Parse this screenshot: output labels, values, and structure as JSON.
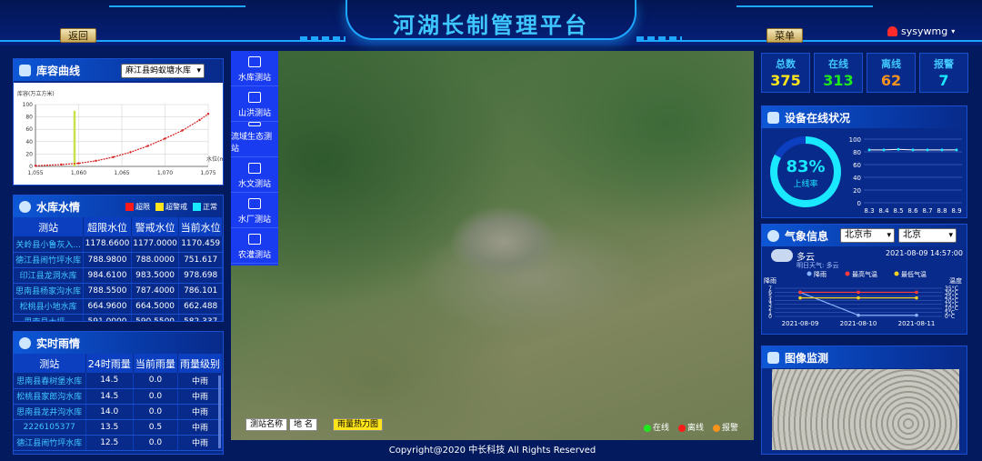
{
  "header": {
    "title": "河湖长制管理平台",
    "back_label": "返回",
    "menu_label": "菜单",
    "username": "sysywmg",
    "user_caret": "▾"
  },
  "reservoir_curve": {
    "title": "库容曲线",
    "selected_reservoir": "麻江县蚂蚁塘水库",
    "chart_data": {
      "type": "line",
      "ylabel": "库容(万立方米)",
      "xlabel": "水位(m)",
      "xlim": [
        1055,
        1075
      ],
      "ylim": [
        0,
        100
      ],
      "x_ticks": [
        "1,055",
        "1,060",
        "1,065",
        "1,070",
        "1,075"
      ],
      "y_ticks": [
        "0",
        "20",
        "40",
        "60",
        "80",
        "100"
      ],
      "series": [
        {
          "values_x": [
            1055,
            1058,
            1060,
            1062,
            1064,
            1066,
            1068,
            1070,
            1072,
            1074,
            1075
          ],
          "values_y": [
            1,
            3,
            5,
            9,
            15,
            23,
            33,
            45,
            58,
            75,
            85
          ],
          "color": "#d81e1e"
        }
      ],
      "marker": {
        "x": 1059.5,
        "y": 90,
        "color": "#c8e04a"
      }
    }
  },
  "reservoir_water": {
    "title": "水库水情",
    "legend": [
      {
        "label": "超限",
        "color": "#ff1a1a"
      },
      {
        "label": "超警戒",
        "color": "#ffe51a"
      },
      {
        "label": "正常",
        "color": "#1ae8ff"
      }
    ],
    "columns": [
      "测站",
      "超限水位",
      "警戒水位",
      "当前水位"
    ],
    "rows": [
      [
        "关岭县小鲁灰入...",
        "1178.6600",
        "1177.0000",
        "1170.459"
      ],
      [
        "德江县闹竹坪水库",
        "788.9800",
        "788.0000",
        "751.617"
      ],
      [
        "印江县龙洞水库",
        "984.6100",
        "983.5000",
        "978.698"
      ],
      [
        "思南县杨家沟水库",
        "788.5500",
        "787.4000",
        "786.101"
      ],
      [
        "松桃县小地水库",
        "664.9600",
        "664.5000",
        "662.488"
      ],
      [
        "思南县大坪...",
        "591.0000",
        "590.5500",
        "582.337"
      ]
    ]
  },
  "rainfall": {
    "title": "实时雨情",
    "columns": [
      "测站",
      "24时雨量",
      "当前雨量",
      "雨量级别"
    ],
    "rows": [
      [
        "思南县春树堡水库",
        "14.5",
        "0.0",
        "中雨"
      ],
      [
        "松桃县家郎沟水库",
        "14.5",
        "0.0",
        "中雨"
      ],
      [
        "思南县龙井沟水库",
        "14.0",
        "0.0",
        "中雨"
      ],
      [
        "2226105377",
        "13.5",
        "0.5",
        "中雨"
      ],
      [
        "德江县闹竹坪水库",
        "12.5",
        "0.0",
        "中雨"
      ]
    ]
  },
  "map": {
    "side_menu": [
      {
        "label": "水库测站",
        "icon": "water-wave-icon"
      },
      {
        "label": "山洪测站",
        "icon": "mountain-flood-icon"
      },
      {
        "label": "流域生态测站",
        "icon": "eco-station-icon"
      },
      {
        "label": "水文测站",
        "icon": "hydrology-icon"
      },
      {
        "label": "水厂测站",
        "icon": "water-plant-icon"
      },
      {
        "label": "农灌测站",
        "icon": "irrigation-icon"
      }
    ],
    "buttons": [
      "测站名称",
      "地 名",
      "雨量热力图"
    ],
    "legend": [
      {
        "label": "在线",
        "color": "#1ee81e"
      },
      {
        "label": "离线",
        "color": "#ff1a1a"
      },
      {
        "label": "报警",
        "color": "#f7931e"
      }
    ]
  },
  "footer": "Copyright@2020 中长科技 All Rights Reserved",
  "stats": [
    {
      "label": "总数",
      "value": "375",
      "color": "#ffe51a"
    },
    {
      "label": "在线",
      "value": "313",
      "color": "#1ee81e"
    },
    {
      "label": "离线",
      "value": "62",
      "color": "#f7931e"
    },
    {
      "label": "报警",
      "value": "7",
      "color": "#1ae8ff"
    }
  ],
  "device_status": {
    "title": "设备在线状况",
    "percent": "83%",
    "percent_value": 83,
    "percent_label": "上线率",
    "chart_data": {
      "type": "line",
      "categories": [
        "8.3",
        "8.4",
        "8.5",
        "8.6",
        "8.7",
        "8.8",
        "8.9"
      ],
      "values": [
        83,
        83,
        84,
        83,
        83,
        83,
        83
      ],
      "ylim": [
        0,
        100
      ],
      "y_ticks": [
        "0",
        "20",
        "40",
        "60",
        "80",
        "100"
      ]
    }
  },
  "weather": {
    "title": "气象信息",
    "province": "北京市",
    "city": "北京",
    "condition": "多云",
    "time": "2021-08-09 14:57:00",
    "tomorrow": "明日天气: 多云",
    "chart_data": {
      "type": "line",
      "ylabel": "降雨",
      "y2label": "温度",
      "categories": [
        "2021-08-09",
        "2021-08-10",
        "2021-08-11"
      ],
      "legend": [
        "降雨",
        "最高气温",
        "最低气温"
      ],
      "y_ticks": [
        "0",
        "1",
        "2",
        "3",
        "4",
        "5",
        "6",
        "7"
      ],
      "y2_ticks": [
        "0°C",
        "5°C",
        "10°C",
        "15°C",
        "20°C",
        "25°C",
        "30°C",
        "35°C"
      ],
      "series": [
        {
          "name": "降雨",
          "values": [
            6,
            0.3,
            0.3
          ],
          "color": "#8ab4ff"
        },
        {
          "name": "最高气温",
          "values": [
            30,
            30,
            30
          ],
          "color": "#ff3a3a"
        },
        {
          "name": "最低气温",
          "values": [
            23,
            23,
            23
          ],
          "color": "#f7d21e"
        }
      ]
    }
  },
  "image_monitor": {
    "title": "图像监测"
  }
}
